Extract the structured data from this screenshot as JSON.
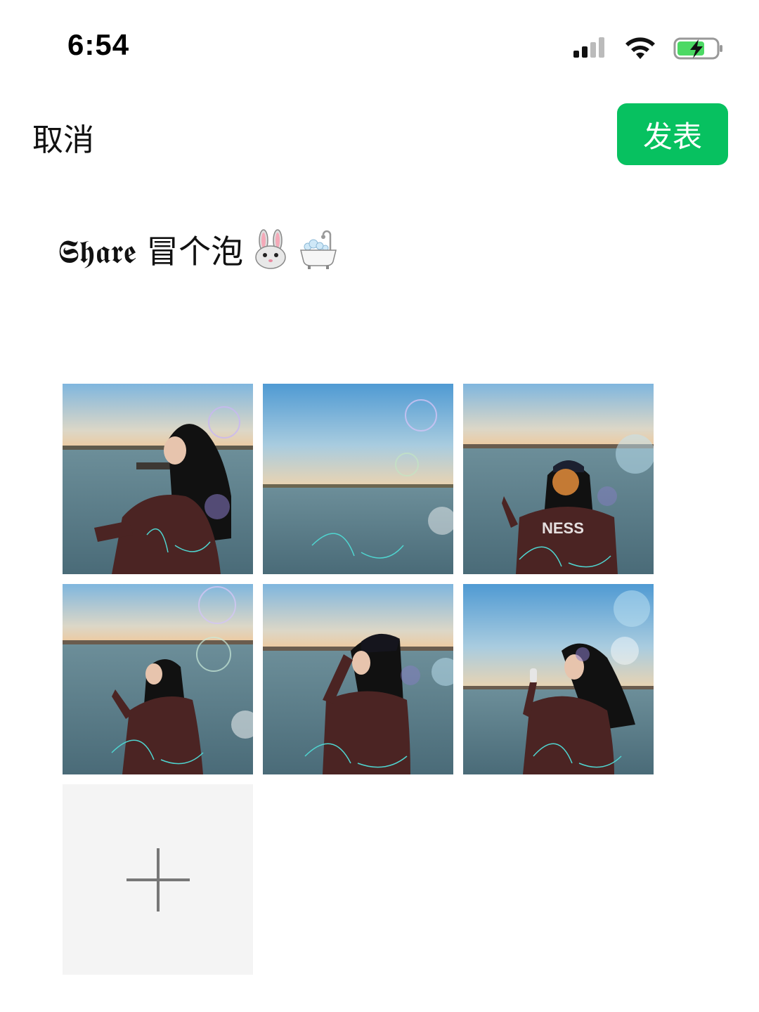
{
  "status_bar": {
    "time": "6:54",
    "icons": [
      "signal-icon",
      "wifi-icon",
      "battery-charging-icon"
    ]
  },
  "nav": {
    "cancel_label": "取消",
    "post_label": "发表",
    "post_color": "#07c160"
  },
  "caption": {
    "text": "𝕾𝖍𝖆𝖗𝖊 冒个泡",
    "emojis": [
      "rabbit-face-icon",
      "bathtub-icon"
    ]
  },
  "photos": [
    {
      "name": "photo-1"
    },
    {
      "name": "photo-2"
    },
    {
      "name": "photo-3"
    },
    {
      "name": "photo-4"
    },
    {
      "name": "photo-5"
    },
    {
      "name": "photo-6"
    }
  ],
  "add_photo": {
    "icon": "plus-icon"
  }
}
